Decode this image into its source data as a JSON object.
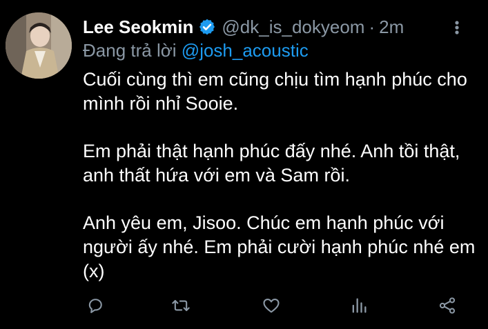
{
  "tweet": {
    "author": {
      "display_name": "Lee Seokmin",
      "verified_icon": "verified-badge-icon",
      "handle": "@dk_is_dokyeom",
      "separator": "·",
      "time": "2m"
    },
    "reply": {
      "prefix": "Đang trả lời",
      "mention": "@josh_acoustic"
    },
    "paragraphs": [
      "Cuối cùng thì em cũng chịu tìm hạnh phúc cho mình rồi nhỉ Sooie.",
      "Em phải thật hạnh phúc đấy nhé. Anh tồi thật, anh thất hứa với em và Sam rồi.",
      "Anh yêu em, Jisoo. Chúc em hạnh phúc với người ấy nhé. Em phải cười hạnh phúc nhé em (x)"
    ],
    "actions": [
      {
        "name": "reply",
        "icon": "comment-icon"
      },
      {
        "name": "retweet",
        "icon": "retweet-icon"
      },
      {
        "name": "like",
        "icon": "heart-icon"
      },
      {
        "name": "analytics",
        "icon": "bar-chart-icon"
      },
      {
        "name": "share",
        "icon": "share-icon"
      }
    ]
  },
  "colors": {
    "background": "#000000",
    "text": "#ffffff",
    "secondary": "#8b98a5",
    "accent": "#1d9bf0"
  }
}
